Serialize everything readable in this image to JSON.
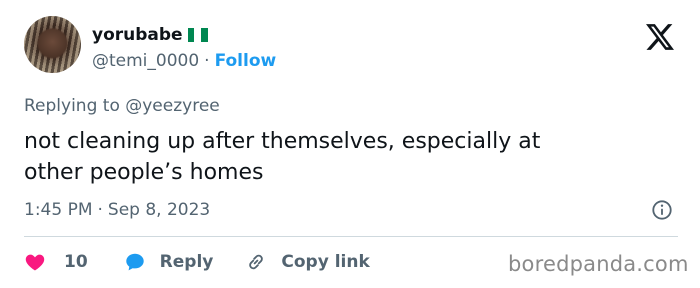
{
  "author": {
    "display_name": "yorubabe",
    "handle": "@temi_0000",
    "separator": "·",
    "follow_label": "Follow",
    "flag_colors": [
      "#008751",
      "#ffffff",
      "#008751"
    ]
  },
  "tweet": {
    "replying_to": "Replying to @yeezyree",
    "text_line1": "not cleaning up after themselves, especially at",
    "text_line2": "other people’s homes",
    "time": "1:45 PM",
    "date_separator": "·",
    "date": "Sep 8, 2023"
  },
  "actions": {
    "like_count": "10",
    "reply_label": "Reply",
    "copy_label": "Copy link"
  },
  "watermark": "boredpanda.com",
  "colors": {
    "accent": "#1d9bf0",
    "like": "#f91880",
    "text": "#0f1419",
    "muted": "#536471"
  }
}
